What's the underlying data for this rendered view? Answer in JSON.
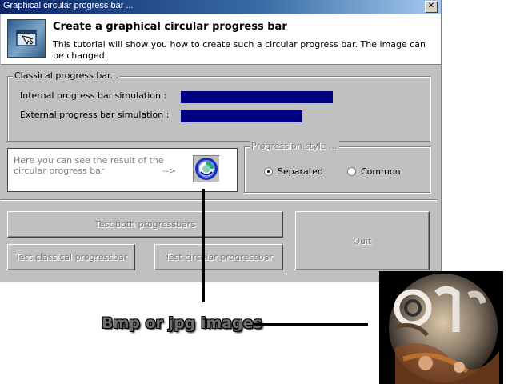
{
  "window": {
    "title": "Graphical circular progress bar ...",
    "close_glyph": "✕"
  },
  "header": {
    "title": "Create a graphical circular progress bar",
    "description": "This tutorial will show you how to create such a circular progress bar. The image can be changed.",
    "icon": "app-window-icon"
  },
  "classical": {
    "legend": "Classical progress bar...",
    "internal_label": "Internal progress bar simulation :",
    "external_label": "External progress bar simulation :",
    "internal_progress": 1.0,
    "external_progress": 0.8
  },
  "result": {
    "text": "Here you can see the result of the circular progress bar",
    "arrow": "-->",
    "icon": "circular-progress-icon"
  },
  "style": {
    "legend": "Progression style ...",
    "options": [
      {
        "label": "Separated",
        "checked": true
      },
      {
        "label": "Common",
        "checked": false
      }
    ]
  },
  "buttons": {
    "test_both": "Test both progressbars",
    "test_classical": "Test classical progressbar",
    "test_circular": "Test circular progressbar",
    "quit": "Quit"
  },
  "annotation": {
    "label": "Bmp or jpg images"
  },
  "colors": {
    "progress_fill": "#000080",
    "window_bg": "#c0c0c0",
    "title_gradient_start": "#0a246a"
  }
}
